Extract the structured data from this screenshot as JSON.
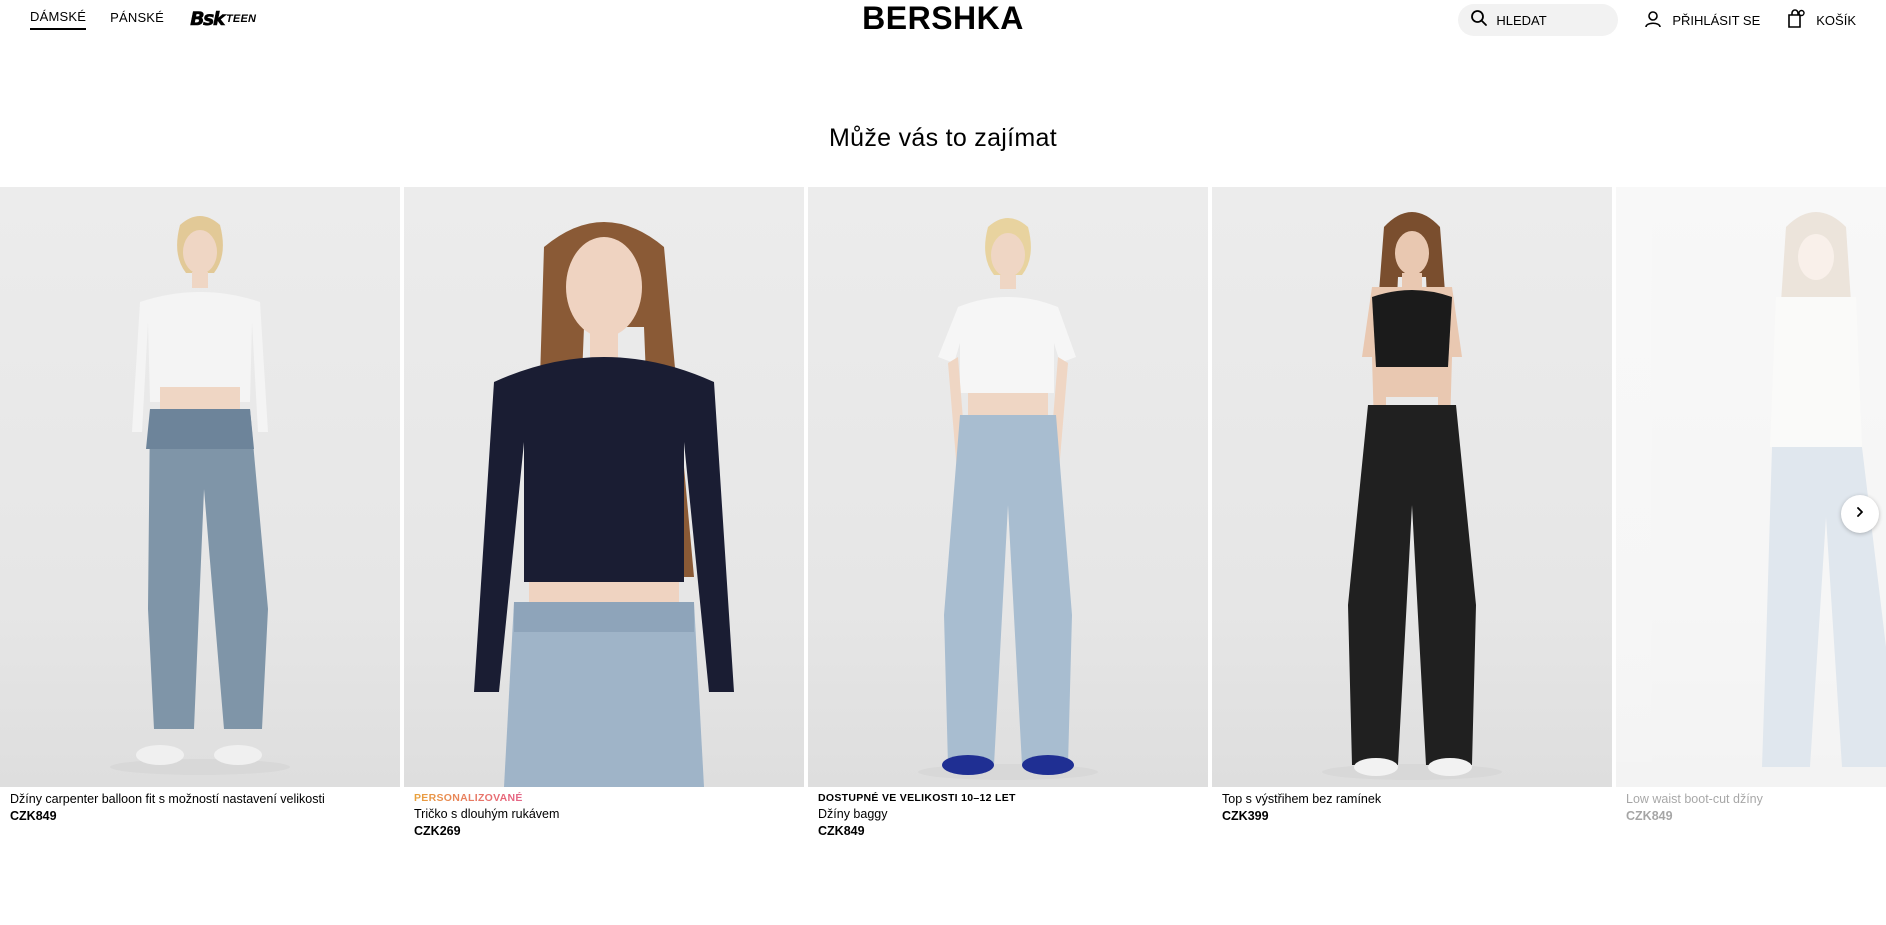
{
  "header": {
    "nav": [
      {
        "label": "DÁMSKÉ",
        "active": true
      },
      {
        "label": "PÁNSKÉ",
        "active": false
      }
    ],
    "teen_logo": {
      "bsk": "Bsk",
      "teen": "TEEN"
    },
    "brand": "BERSHKA",
    "search_placeholder": "HLEDAT",
    "login_label": "PŘIHLÁSIT SE",
    "cart_label": "KOŠÍK"
  },
  "section": {
    "title": "Může vás to zajímat"
  },
  "products": [
    {
      "tag": "",
      "name": "Džíny carpenter balloon fit s možností nastavení velikosti",
      "price": "CZK849",
      "top_color": "#f4f4f4",
      "bottom_color": "#7f95a8"
    },
    {
      "tag": "PERSONALIZOVANÉ",
      "name": "Tričko s dlouhým rukávem",
      "price": "CZK269",
      "top_color": "#1a1d33",
      "bottom_color": "#9fb4c8"
    },
    {
      "tag": "DOSTUPNÉ VE VELIKOSTI 10–12 LET",
      "name": "Džíny baggy",
      "price": "CZK849",
      "top_color": "#f6f6f6",
      "bottom_color": "#a8bdd0"
    },
    {
      "tag": "",
      "name": "Top s výstřihem bez ramínek",
      "price": "CZK399",
      "top_color": "#1b1b1b",
      "bottom_color": "#202020"
    },
    {
      "tag": "",
      "name": "Low waist boot-cut džíny",
      "price": "CZK849",
      "top_color": "#f2f2ee",
      "bottom_color": "#a8bccf"
    }
  ],
  "icons": [
    "search-icon",
    "user-icon",
    "bag-icon",
    "chevron-right-icon"
  ]
}
